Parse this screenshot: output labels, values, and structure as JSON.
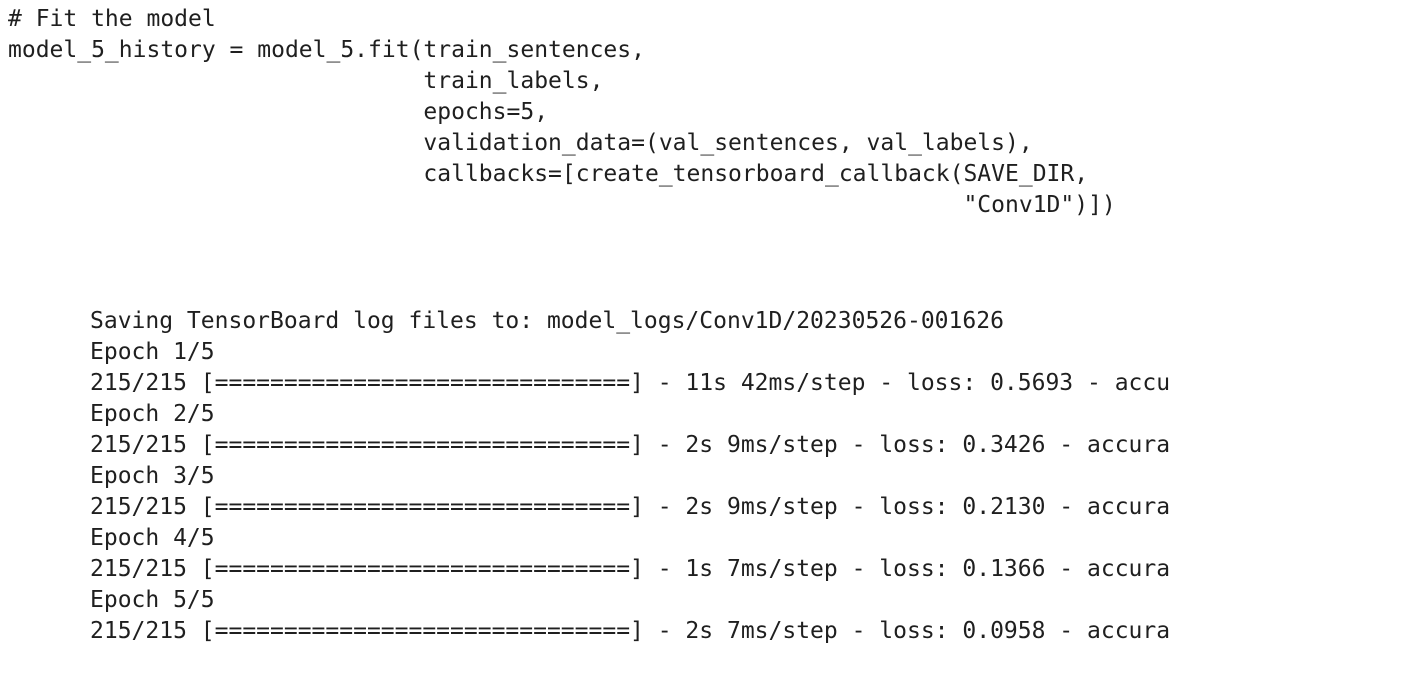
{
  "code": {
    "lines": [
      "# Fit the model",
      "model_5_history = model_5.fit(train_sentences,",
      "                              train_labels,",
      "                              epochs=5,",
      "                              validation_data=(val_sentences, val_labels),",
      "                              callbacks=[create_tensorboard_callback(SAVE_DIR,",
      "                                                                     \"Conv1D\")])"
    ]
  },
  "output": {
    "lines": [
      "Saving TensorBoard log files to: model_logs/Conv1D/20230526-001626",
      "Epoch 1/5",
      "215/215 [==============================] - 11s 42ms/step - loss: 0.5693 - accu",
      "Epoch 2/5",
      "215/215 [==============================] - 2s 9ms/step - loss: 0.3426 - accura",
      "Epoch 3/5",
      "215/215 [==============================] - 2s 9ms/step - loss: 0.2130 - accura",
      "Epoch 4/5",
      "215/215 [==============================] - 1s 7ms/step - loss: 0.1366 - accura",
      "Epoch 5/5",
      "215/215 [==============================] - 2s 7ms/step - loss: 0.0958 - accura"
    ]
  }
}
